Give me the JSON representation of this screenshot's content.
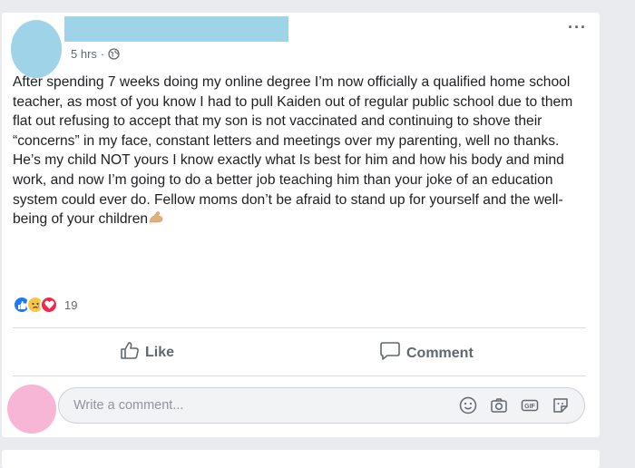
{
  "post": {
    "timestamp": "5 hrs",
    "separator": "·",
    "privacy_icon": "globe-icon",
    "more_icon": "more-horizontal-icon",
    "text": "After spending 7 weeks doing my online degree I’m now officially a qualified home school teacher, as most of you know I had to pull Kaiden out of regular public school due to them flat out refusing to accept that my son is not vaccinated and continuing to shove their “concerns” in my face, constant letters and meetings over my parenting, well no thanks. He’s my child NOT yours I know exactly what Is best for him and how his body and mind work, and now I’m going to do a better job teaching him than your joke of an education system could ever do. Fellow moms don’t be afraid to stand up for yourself and the well-being of your children",
    "text_emoji": "flexed-bicep-emoji"
  },
  "reactions": {
    "icons": [
      "like-reaction-icon",
      "sad-reaction-icon",
      "love-reaction-icon"
    ],
    "count": "19"
  },
  "actions": {
    "like_label": "Like",
    "comment_label": "Comment"
  },
  "comment_input": {
    "placeholder": "Write a comment...",
    "icons": [
      "emoji-icon",
      "camera-icon",
      "gif-icon",
      "sticker-icon"
    ]
  },
  "colors": {
    "avatar_redaction": "#9fd3e8",
    "commenter_avatar": "#f7b6d6",
    "like_blue": "#2078f4",
    "love_red": "#f0284a",
    "sad_yellow": "#f7c644"
  }
}
